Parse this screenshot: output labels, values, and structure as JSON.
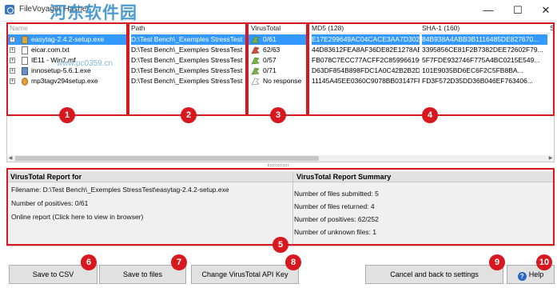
{
  "window": {
    "title": "FileVoyager Hasher",
    "watermark": "河东软件园",
    "watermark_url": "www.pc0359.cn",
    "minimize": "—",
    "maximize": "☐",
    "close": "✕"
  },
  "columns": {
    "name": "Name",
    "path": "Path",
    "virustotal": "VirusTotal",
    "md5": "MD5 (128)",
    "sha1": "SHA-1 (160)",
    "more": "S"
  },
  "rows": [
    {
      "name": "easytag-2.4.2-setup.exe",
      "path": "D:\\Test Bench\\_Exemples StressTest",
      "vt": "0/61",
      "md5": "E17E299649AC04CACE3AA7D302F...",
      "sha1": "84B938A4ABB3B1116485DE827670...",
      "selected": true,
      "icon": "package-icon"
    },
    {
      "name": "eicar.com.txt",
      "path": "D:\\Test Bench\\_Exemples StressTest",
      "vt": "62/63",
      "md5": "44D83612FEA8AF36DE82E1278AB...",
      "sha1": "3395856CE81F2B7382DEE72602F79...",
      "selected": false,
      "icon": "text-file-icon"
    },
    {
      "name": "IE11 - Win7.mf",
      "path": "D:\\Test Bench\\_Exemples StressTest",
      "vt": "0/57",
      "md5": "FB078C7ECC77ACFF2C85996619C...",
      "sha1": "5F7FDE932746F775A4BC0215E549...",
      "selected": false,
      "icon": "document-icon"
    },
    {
      "name": "innosetup-5.6.1.exe",
      "path": "D:\\Test Bench\\_Exemples StressTest",
      "vt": "0/71",
      "md5": "D63DF854B898FDC1A0C42B2B2DD...",
      "sha1": "101E9035BD6EC6F2C5FB8BA...",
      "selected": false,
      "icon": "installer-icon"
    },
    {
      "name": "mp3tagv294setup.exe",
      "path": "D:\\Test Bench\\_Exemples StressTest",
      "vt": "No response",
      "md5": "11145A45EE0360C9078BB03147FF...",
      "sha1": "FD3F572D35DD36B046EF763406...",
      "selected": false,
      "icon": "mp3tag-icon"
    }
  ],
  "report": {
    "left_header": "VirusTotal Report for",
    "filename": "Filename: D:\\Test Bench\\_Exemples StressTest\\easytag-2.4.2-setup.exe",
    "positives": "Number of positives: 0/61",
    "online": "Online report (Click here to view in browser)",
    "right_header": "VirusTotal Report Summary",
    "submitted": "Number of files submitted: 5",
    "returned": "Number of files returned: 4",
    "total_positives": "Number of positives: 62/252",
    "unknown": "Number of unknown files: 1"
  },
  "buttons": {
    "save_csv": "Save to CSV",
    "save_files": "Save to files",
    "change_key": "Change VirusTotal API Key",
    "cancel": "Cancel and back to settings",
    "help": "Help"
  },
  "badges": [
    "1",
    "2",
    "3",
    "4",
    "5",
    "6",
    "7",
    "8",
    "9",
    "10"
  ],
  "colors": {
    "highlight": "#d8181f",
    "selection": "#3399ff"
  }
}
